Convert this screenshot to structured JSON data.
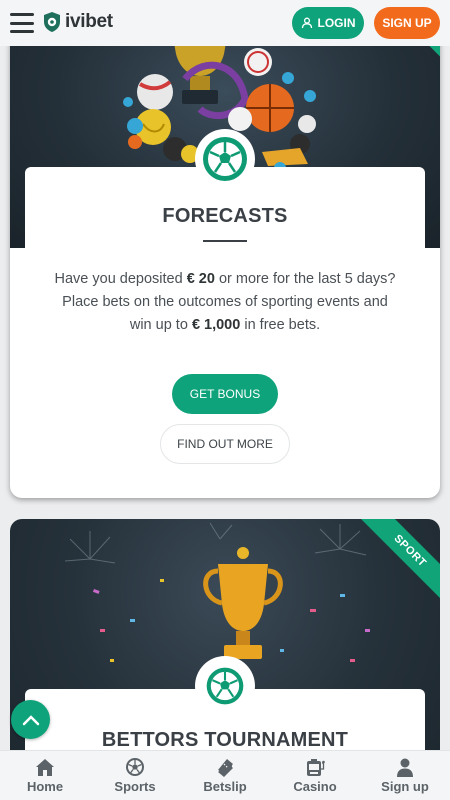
{
  "header": {
    "brand": "ivibet",
    "login_label": "LOGIN",
    "signup_label": "SIGN UP"
  },
  "promo1": {
    "title": "FORECASTS",
    "desc_line1_a": "Have you deposited ",
    "desc_line1_amount": "€ 20",
    "desc_line1_b": " or more for the last 5 days?",
    "desc_line2": "Place bets on the outcomes of sporting events and",
    "desc_line3_a": "win up to ",
    "desc_line3_amount": "€ 1,000",
    "desc_line3_b": " in free bets.",
    "primary_button": "GET BONUS",
    "secondary_button": "FIND OUT MORE"
  },
  "promo2": {
    "ribbon": "SPORT",
    "title": "BETTORS TOURNAMENT"
  },
  "bottom_nav": [
    {
      "label": "Home",
      "icon": "home-icon"
    },
    {
      "label": "Sports",
      "icon": "soccer-ball-icon"
    },
    {
      "label": "Betslip",
      "icon": "ticket-icon"
    },
    {
      "label": "Casino",
      "icon": "slot-machine-icon"
    },
    {
      "label": "Sign up",
      "icon": "user-icon"
    }
  ],
  "colors": {
    "accent_green": "#0ea37a",
    "accent_orange": "#f26b1d",
    "banner_dark": "#243039"
  }
}
